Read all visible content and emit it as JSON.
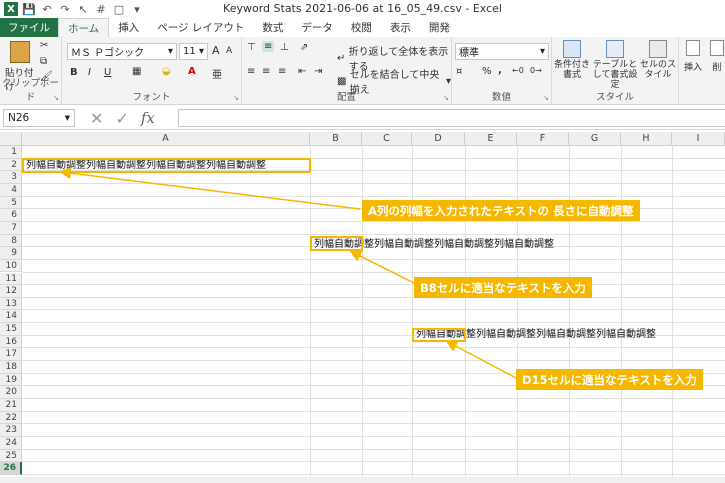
{
  "window": {
    "title": "Keyword Stats 2021-06-06 at 16_05_49.csv - Excel"
  },
  "tabs": [
    "ファイル",
    "ホーム",
    "挿入",
    "ページ レイアウト",
    "数式",
    "データ",
    "校閲",
    "表示",
    "開発"
  ],
  "ribbon": {
    "clipboard": {
      "paste": "貼り付け",
      "label": "クリップボード"
    },
    "font": {
      "name": "ＭＳ Ｐゴシック",
      "size": "11",
      "bold": "B",
      "italic": "I",
      "underline": "U",
      "label": "フォント",
      "grow": "A",
      "shrink": "A"
    },
    "alignment": {
      "wrap": "折り返して全体を表示する",
      "merge": "セルを結合して中央揃え",
      "label": "配置"
    },
    "number": {
      "format": "標準",
      "percent": "%",
      "comma": ",",
      "label": "数値"
    },
    "styles": {
      "conditional": "条件付き書式",
      "table": "テーブルとして書式設定",
      "cell": "セルのスタイル",
      "label": "スタイル"
    },
    "cells": {
      "insert": "挿入",
      "delete": "削"
    }
  },
  "formula_bar": {
    "name_box": "N26",
    "fx": "fx",
    "value": ""
  },
  "columns": [
    "A",
    "B",
    "C",
    "D",
    "E",
    "F",
    "G",
    "H",
    "I"
  ],
  "rows": [
    "1",
    "2",
    "3",
    "4",
    "5",
    "6",
    "7",
    "8",
    "9",
    "10",
    "11",
    "12",
    "13",
    "14",
    "15",
    "16",
    "17",
    "18",
    "19",
    "20",
    "21",
    "22",
    "23",
    "24",
    "25",
    "26"
  ],
  "selected_row": "26",
  "cells": {
    "A2": "列幅自動調整列幅自動調整列幅自動調整列幅自動調整",
    "B8": "列幅自動調整列幅自動調整列幅自動調整列幅自動調整",
    "D15": "列幅自動調整列幅自動調整列幅自動調整列幅自動調整"
  },
  "callouts": {
    "a": "A列の列幅を入力されたテキストの 長さに自動調整",
    "b": "B8セルに適当なテキストを入力",
    "c": "D15セルに適当なテキストを入力"
  },
  "accent_color": "#217346",
  "highlight_color": "#f5b700"
}
